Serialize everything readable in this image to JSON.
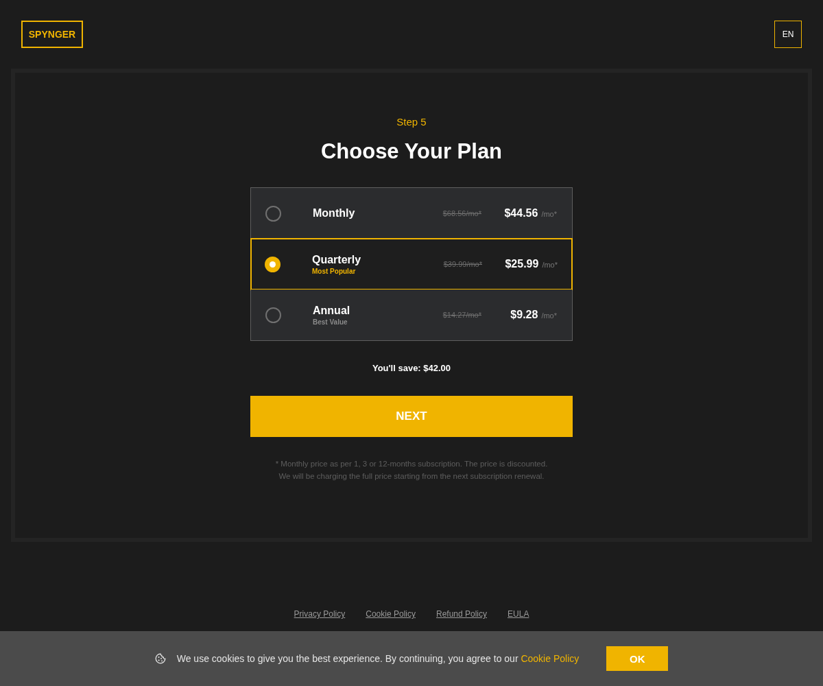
{
  "header": {
    "logo": "SPYNGER",
    "language": "EN"
  },
  "step": "Step 5",
  "title": "Choose Your Plan",
  "plans": [
    {
      "name": "Monthly",
      "old_price": "$68.56/mo*",
      "price": "$44.56",
      "unit": "/mo*",
      "selected": false
    },
    {
      "name": "Quarterly",
      "tag": "Most Popular",
      "old_price": "$39.99/mo*",
      "price": "$25.99",
      "unit": "/mo*",
      "selected": true
    },
    {
      "name": "Annual",
      "tag": "Best Value",
      "old_price": "$14.27/mo*",
      "price": "$9.28",
      "unit": "/mo*",
      "selected": false
    }
  ],
  "savings": "You'll save: $42.00",
  "next_button": "NEXT",
  "disclaimer": [
    "* Monthly price as per 1, 3 or 12-months subscription. The price is discounted.",
    "We will be charging the full price starting from the next subscription renewal."
  ],
  "footer_links": [
    "Privacy Policy",
    "Cookie Policy",
    "Refund Policy",
    "EULA"
  ],
  "cookie_banner": {
    "text": "We use cookies to give you the best experience. By continuing, you agree to our",
    "link": "Cookie Policy",
    "button": "OK"
  }
}
